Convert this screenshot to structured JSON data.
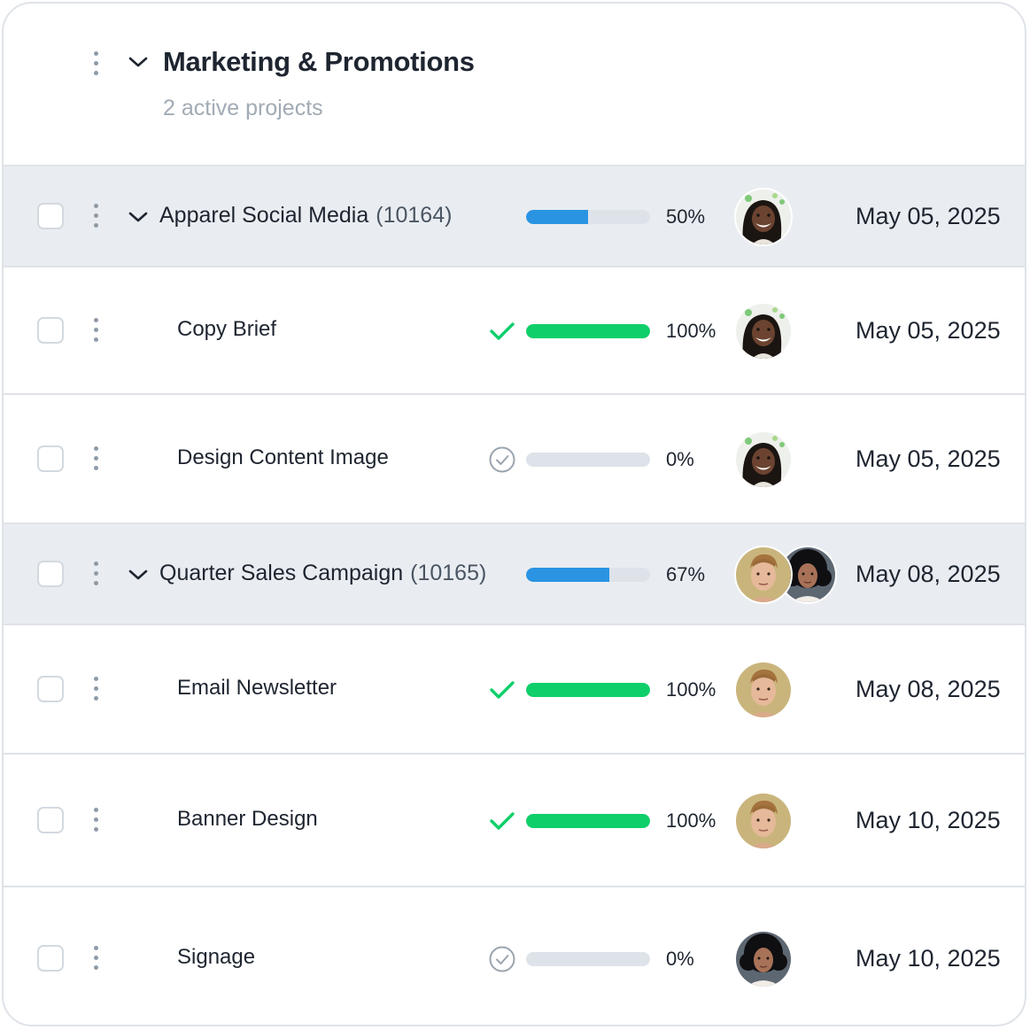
{
  "section": {
    "title": "Marketing & Promotions",
    "subtitle": "2 active projects"
  },
  "rows": [
    {
      "kind": "group",
      "name": "Apparel Social Media",
      "code": "(10164)",
      "progress_percent": 50,
      "percent_label": "50%",
      "assignees": [
        "girl-avatar"
      ],
      "date": "May 05, 2025"
    },
    {
      "kind": "task",
      "name": "Copy Brief",
      "status": "complete",
      "progress_percent": 100,
      "percent_label": "100%",
      "assignees": [
        "girl-avatar"
      ],
      "date": "May 05, 2025"
    },
    {
      "kind": "task",
      "name": "Design Content Image",
      "status": "pending",
      "progress_percent": 0,
      "percent_label": "0%",
      "assignees": [
        "girl-avatar"
      ],
      "date": "May 05, 2025"
    },
    {
      "kind": "group",
      "name": "Quarter Sales Campaign",
      "code": "(10165)",
      "progress_percent": 67,
      "percent_label": "67%",
      "assignees": [
        "man-avatar",
        "woman-avatar"
      ],
      "date": "May 08, 2025"
    },
    {
      "kind": "task",
      "name": "Email Newsletter",
      "status": "complete",
      "progress_percent": 100,
      "percent_label": "100%",
      "assignees": [
        "man-avatar"
      ],
      "date": "May 08, 2025"
    },
    {
      "kind": "task",
      "name": "Banner Design",
      "status": "complete",
      "progress_percent": 100,
      "percent_label": "100%",
      "assignees": [
        "man-avatar"
      ],
      "date": "May 10, 2025"
    },
    {
      "kind": "task",
      "name": "Signage",
      "status": "pending",
      "progress_percent": 0,
      "percent_label": "0%",
      "assignees": [
        "woman-avatar"
      ],
      "date": "May 10, 2025"
    }
  ],
  "colors": {
    "group_progress": "#2a94e2",
    "task_progress": "#0ecf6a",
    "check": "#0ecf6a",
    "group_background": "#e9edf1"
  }
}
